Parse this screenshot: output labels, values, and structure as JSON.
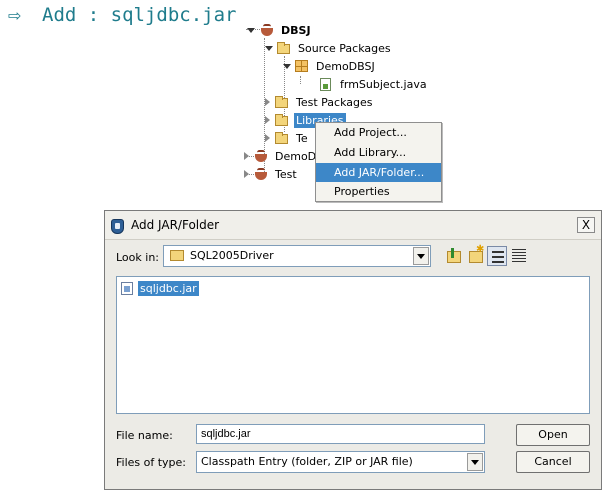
{
  "heading": {
    "arrow": "⇨",
    "text": "Add : sqljdbc.jar"
  },
  "tree": {
    "root": "DBSJ",
    "source_packages": "Source Packages",
    "package": "DemoDBSJ",
    "file": "frmSubject.java",
    "test_packages": "Test Packages",
    "libraries": "Libraries",
    "test_libraries_partial": "Te",
    "project2_partial": "DemoD",
    "project3": "Test"
  },
  "context_menu": {
    "items": [
      "Add Project...",
      "Add Library...",
      "Add JAR/Folder...",
      "Properties"
    ],
    "highlighted": "Add JAR/Folder..."
  },
  "dialog": {
    "title": "Add JAR/Folder",
    "close_glyph": "X",
    "look_in_label": "Look in:",
    "look_in_value": "SQL2005Driver",
    "files": [
      "sqljdbc.jar"
    ],
    "file_name_label": "File name:",
    "file_name_value": "sqljdbc.jar",
    "file_type_label": "Files of type:",
    "file_type_value": "Classpath Entry (folder, ZIP or JAR file)",
    "open_label": "Open",
    "cancel_label": "Cancel"
  },
  "icons": {
    "toolbar": [
      "up-folder-icon",
      "new-folder-icon",
      "list-view-icon",
      "details-view-icon"
    ]
  },
  "colors": {
    "selection": "#3d87c8",
    "heading": "#1f7c8c"
  }
}
